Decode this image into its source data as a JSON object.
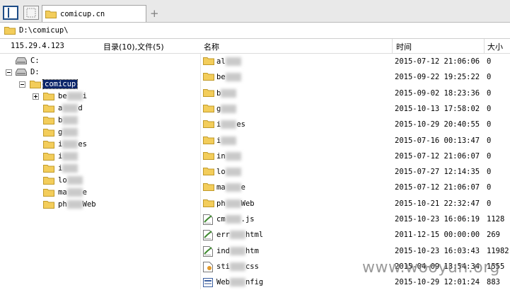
{
  "tab": {
    "title": "comicup.cn"
  },
  "tab_add_symbol": "+",
  "address": {
    "path": "D:\\comicup\\"
  },
  "status": {
    "ip": "115.29.4.123",
    "counts": "目录(10),文件(5)"
  },
  "columns": {
    "name": "名称",
    "time": "时间",
    "size": "大小"
  },
  "tree": {
    "drive_c": "C:",
    "drive_d": "D:",
    "selected": "comicup",
    "children": [
      {
        "prefix": "be",
        "suffix": "i",
        "expandable": true
      },
      {
        "prefix": "a",
        "suffix": "d",
        "expandable": false
      },
      {
        "prefix": "b",
        "suffix": "",
        "expandable": false
      },
      {
        "prefix": "g",
        "suffix": "",
        "expandable": false
      },
      {
        "prefix": "i",
        "suffix": "es",
        "expandable": false
      },
      {
        "prefix": "i",
        "suffix": "",
        "expandable": false
      },
      {
        "prefix": "i",
        "suffix": "",
        "expandable": false
      },
      {
        "prefix": "lo",
        "suffix": "",
        "expandable": false
      },
      {
        "prefix": "ma",
        "suffix": "e",
        "expandable": false
      },
      {
        "prefix": "ph",
        "suffix": "Web",
        "expandable": false
      }
    ]
  },
  "files": [
    {
      "type": "folder",
      "prefix": "al",
      "suffix": "",
      "time": "2015-07-12 21:06:06",
      "size": "0"
    },
    {
      "type": "folder",
      "prefix": "be",
      "suffix": "",
      "time": "2015-09-22 19:25:22",
      "size": "0"
    },
    {
      "type": "folder",
      "prefix": "b",
      "suffix": "",
      "time": "2015-09-02 18:23:36",
      "size": "0"
    },
    {
      "type": "folder",
      "prefix": "g",
      "suffix": "",
      "time": "2015-10-13 17:58:02",
      "size": "0"
    },
    {
      "type": "folder",
      "prefix": "i",
      "suffix": "es",
      "time": "2015-10-29 20:40:55",
      "size": "0"
    },
    {
      "type": "folder",
      "prefix": "i",
      "suffix": "",
      "time": "2015-07-16 00:13:47",
      "size": "0"
    },
    {
      "type": "folder",
      "prefix": "in",
      "suffix": "",
      "time": "2015-07-12 21:06:07",
      "size": "0"
    },
    {
      "type": "folder",
      "prefix": "lo",
      "suffix": "",
      "time": "2015-07-27 12:14:35",
      "size": "0"
    },
    {
      "type": "folder",
      "prefix": "ma",
      "suffix": "e",
      "time": "2015-07-12 21:06:07",
      "size": "0"
    },
    {
      "type": "folder",
      "prefix": "ph",
      "suffix": "Web",
      "time": "2015-10-21 22:32:47",
      "size": "0"
    },
    {
      "type": "script",
      "prefix": "cm",
      "suffix": ".js",
      "time": "2015-10-23 16:06:19",
      "size": "1128"
    },
    {
      "type": "script",
      "prefix": "err",
      "suffix": "html",
      "time": "2011-12-15 00:00:00",
      "size": "269"
    },
    {
      "type": "script",
      "prefix": "ind",
      "suffix": "htm",
      "time": "2015-10-23 16:03:43",
      "size": "11982"
    },
    {
      "type": "css",
      "prefix": "sti",
      "suffix": "css",
      "time": "2015-04-09 13:54:34",
      "size": "1555"
    },
    {
      "type": "config",
      "prefix": "Web",
      "suffix": "nfig",
      "time": "2015-10-29 12:01:24",
      "size": "883"
    }
  ],
  "watermark": "www.wooyun.org",
  "colors": {
    "selection": "#0a246a",
    "folder": "#f3cd5b",
    "folder_edge": "#c09a2a"
  }
}
